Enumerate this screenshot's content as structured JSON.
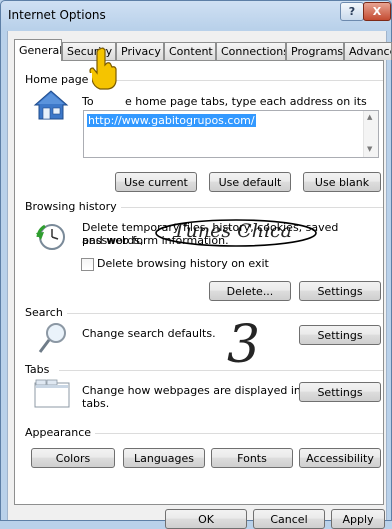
{
  "window": {
    "title": "Internet Options",
    "help": "?",
    "close": "X"
  },
  "tabs": [
    "General",
    "Security",
    "Privacy",
    "Content",
    "Connections",
    "Programs",
    "Advanced"
  ],
  "home_page": {
    "section": "Home page",
    "instruction": "To create home page tabs, type each address on its own line.",
    "instruction_visible_prefix": "To",
    "instruction_visible_suffix": "e home page tabs, type each address on its own line.",
    "url": "http://www.gabitogrupos.com/",
    "buttons": {
      "use_current": "Use current",
      "use_default": "Use default",
      "use_blank": "Use blank"
    }
  },
  "browsing_history": {
    "section": "Browsing history",
    "line1": "Delete temporary files, history, cookies, saved passwords,",
    "line2": "and web form information.",
    "checkbox_label": "Delete browsing history on exit",
    "checkbox_checked": false,
    "buttons": {
      "delete": "Delete...",
      "settings": "Settings"
    }
  },
  "search": {
    "section": "Search",
    "text": "Change search defaults.",
    "settings": "Settings"
  },
  "tabs_section": {
    "section": "Tabs",
    "line1": "Change how webpages are displayed in",
    "line2": "tabs.",
    "settings": "Settings"
  },
  "appearance": {
    "section": "Appearance",
    "buttons": {
      "colors": "Colors",
      "languages": "Languages",
      "fonts": "Fonts",
      "accessibility": "Accessibility"
    }
  },
  "dialog_buttons": {
    "ok": "OK",
    "cancel": "Cancel",
    "apply": "Apply"
  },
  "watermark": {
    "text": "Tunes Chica",
    "digit": "3"
  },
  "colors": {
    "selection": "#3399ff",
    "chrome": "#b9d1ea",
    "cursor": "#f5c400"
  }
}
